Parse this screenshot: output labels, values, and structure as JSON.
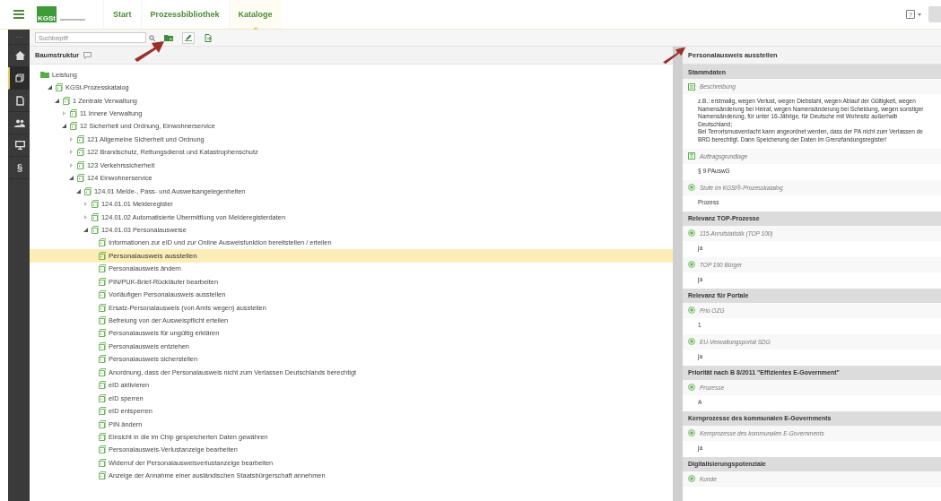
{
  "nav": {
    "logo_text": "KGSt",
    "tabs": [
      {
        "label": "Start",
        "selected": false
      },
      {
        "label": "Prozessbibliothek",
        "selected": false
      },
      {
        "label": "Kataloge",
        "selected": true
      }
    ],
    "help_label": "?"
  },
  "sidebar": {
    "more": "···",
    "items": [
      {
        "kind": "home",
        "selected": false
      },
      {
        "kind": "catalog",
        "selected": true
      },
      {
        "kind": "document",
        "selected": false
      },
      {
        "kind": "people",
        "selected": false
      },
      {
        "kind": "monitor",
        "selected": false
      },
      {
        "kind": "law",
        "label": "§",
        "selected": false
      }
    ]
  },
  "toolbar": {
    "search": {
      "placeholder": "Suchbegriff"
    }
  },
  "tree": {
    "title": "Baumstruktur",
    "items": [
      {
        "label": "Leistung",
        "selected": false,
        "children": [
          {
            "label": "KGSt-Prozesskatalog",
            "expanded": true,
            "selected": false,
            "children": [
              {
                "label": "1 Zentrale Verwaltung",
                "expanded": true,
                "selected": false,
                "children": [
                  {
                    "label": "11 Innere Verwaltung",
                    "expanded": false,
                    "selected": false
                  },
                  {
                    "label": "12 Sicherheit und Ordnung, Einwohnerservice",
                    "expanded": true,
                    "selected": false,
                    "children": [
                      {
                        "label": "121 Allgemeine Sicherheit und Ordnung",
                        "expanded": false,
                        "selected": false
                      },
                      {
                        "label": "122 Brandschutz, Rettungsdienst und Katastrophenschutz",
                        "expanded": false,
                        "selected": false
                      },
                      {
                        "label": "123 Verkehrssicherheit",
                        "expanded": false,
                        "selected": false
                      },
                      {
                        "label": "124 Einwohnerservice",
                        "expanded": true,
                        "selected": false,
                        "children": [
                          {
                            "label": "124.01 Melde-, Pass- und Ausweisangelegenheiten",
                            "expanded": true,
                            "selected": false,
                            "children": [
                              {
                                "label": "124.01.01 Melderegister",
                                "expanded": false,
                                "selected": false
                              },
                              {
                                "label": "124.01.02 Automatisierte Übermittlung von Melderegisterdaten",
                                "expanded": false,
                                "selected": false
                              },
                              {
                                "label": "124.01.03 Personalausweise",
                                "expanded": true,
                                "selected": false,
                                "children": [
                                  {
                                    "label": "Informationen zur eID und zur Online Ausweisfunktion bereitstellen / erteilen",
                                    "selected": false
                                  },
                                  {
                                    "label": "Personalausweis ausstellen",
                                    "selected": true
                                  },
                                  {
                                    "label": "Personalausweis ändern",
                                    "selected": false
                                  },
                                  {
                                    "label": "PIN/PUK-Brief-Rückläufer bearbeiten",
                                    "selected": false
                                  },
                                  {
                                    "label": "Vorläufigen Personalausweis ausstellen",
                                    "selected": false
                                  },
                                  {
                                    "label": "Ersatz-Personalausweis (von Amts wegen) ausstellen",
                                    "selected": false
                                  },
                                  {
                                    "label": "Befreiung von der Ausweispflicht erteilen",
                                    "selected": false
                                  },
                                  {
                                    "label": "Personalausweis für ungültig erklären",
                                    "selected": false
                                  },
                                  {
                                    "label": "Personalausweis entziehen",
                                    "selected": false
                                  },
                                  {
                                    "label": "Personalausweis sicherstellen",
                                    "selected": false
                                  },
                                  {
                                    "label": "Anordnung, dass der Personalausweis nicht zum Verlassen Deutschlands berechtigt",
                                    "selected": false
                                  },
                                  {
                                    "label": "eID aktivieren",
                                    "selected": false
                                  },
                                  {
                                    "label": "eID sperren",
                                    "selected": false
                                  },
                                  {
                                    "label": "eID entsperren",
                                    "selected": false
                                  },
                                  {
                                    "label": "PIN ändern",
                                    "selected": false
                                  },
                                  {
                                    "label": "Einsicht in die im Chip gespeicherten Daten gewähren",
                                    "selected": false
                                  },
                                  {
                                    "label": "Personalausweis-Verlustanzeige bearbeiten",
                                    "selected": false
                                  },
                                  {
                                    "label": "Widerruf der Personalausweisverlustanzeige bearbeiten",
                                    "selected": false
                                  },
                                  {
                                    "label": "Anzeige der Annahme einer ausländischen Staatsbürgerschaft annehmen",
                                    "selected": false
                                  }
                                ]
                              }
                            ]
                          }
                        ]
                      }
                    ]
                  }
                ]
              }
            ]
          }
        ]
      }
    ]
  },
  "detail": {
    "title": "Personalausweis ausstellen",
    "sections": [
      {
        "title": "Stammdaten",
        "fields": [
          {
            "kind": "text",
            "label": "Beschreibung",
            "value_lines": [
              "z.B.: erstmalig, wegen Verlust, wegen Diebstahl, wegen Ablauf der Gültigkeit, wegen",
              "Namensänderung bei Heirat, wegen Namensänderung bei Scheidung, wegen sonstiger",
              "Namensänderung, für unter 16-Jährige, für Deutsche mit Wohnsitz außerhalb",
              "Deutschland;",
              "Bei Terrorismusverdacht kann angeordnet werden, dass der PA nicht zum Verlassen de",
              "BRD berechtigt. Dann Speicherung der Daten im Grenzfandungsregister!"
            ]
          },
          {
            "kind": "type",
            "label": "Auftragsgrundlage",
            "value_lines": [
              "§ 9 PAuswG"
            ]
          },
          {
            "kind": "radio",
            "label": "Stufe im KGSt®-Prozesskatalog",
            "value_lines": [
              "Prozess"
            ]
          }
        ]
      },
      {
        "title": "Relevanz TOP-Prozesse",
        "fields": [
          {
            "kind": "radio",
            "label": "115-Anrufstatistik (TOP 100)",
            "value_lines": [
              "ja"
            ]
          },
          {
            "kind": "radio",
            "label": "TOP 100 Bürger",
            "value_lines": [
              "ja"
            ]
          }
        ]
      },
      {
        "title": "Relevanz für Portale",
        "fields": [
          {
            "kind": "radio",
            "label": "Prio OZG",
            "value_lines": [
              "1"
            ]
          },
          {
            "kind": "radio",
            "label": "EU-Verwaltungsportal SDG",
            "value_lines": [
              "ja"
            ]
          }
        ]
      },
      {
        "title": "Priorität nach B 8/2011 \"Effizientes E-Government\"",
        "fields": [
          {
            "kind": "radio",
            "label": "Prozesse",
            "value_lines": [
              "A"
            ]
          }
        ]
      },
      {
        "title": "Kernprozesse des kommunalen E-Governments",
        "fields": [
          {
            "kind": "radio",
            "label": "Kernprozesse des kommunalen E-Governments",
            "value_lines": [
              "ja"
            ]
          }
        ]
      },
      {
        "title": "Digitalisierungspotenziale",
        "fields": [
          {
            "kind": "radio",
            "label": "Kunde"
          }
        ]
      }
    ]
  }
}
